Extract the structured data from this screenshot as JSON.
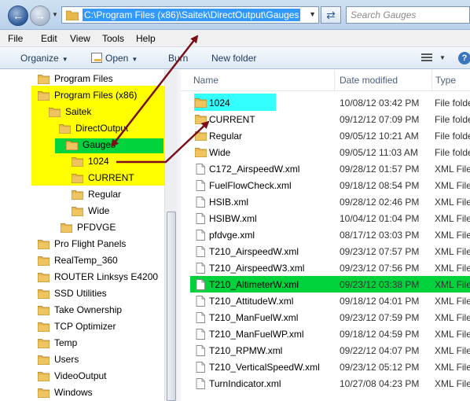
{
  "address": {
    "path": "C:\\Program Files (x86)\\Saitek\\DirectOutput\\Gauges"
  },
  "search": {
    "placeholder": "Search Gauges"
  },
  "menu": [
    "File",
    "Edit",
    "View",
    "Tools",
    "Help"
  ],
  "toolbar": {
    "organize": "Organize",
    "open": "Open",
    "burn": "Burn",
    "new_folder": "New folder"
  },
  "columns": {
    "name": "Name",
    "date": "Date modified",
    "type": "Type"
  },
  "tree": [
    {
      "label": "Program Files"
    },
    {
      "label": "Program Files (x86)"
    },
    {
      "label": "Saitek"
    },
    {
      "label": "DirectOutput"
    },
    {
      "label": "Gauges"
    },
    {
      "label": "1024"
    },
    {
      "label": "CURRENT"
    },
    {
      "label": "Regular"
    },
    {
      "label": "Wide"
    },
    {
      "label": "PFDVGE"
    },
    {
      "label": "Pro Flight Panels"
    },
    {
      "label": "RealTemp_360"
    },
    {
      "label": "ROUTER Linksys E4200"
    },
    {
      "label": "SSD Utilities"
    },
    {
      "label": "Take Ownership"
    },
    {
      "label": "TCP Optimizer"
    },
    {
      "label": "Temp"
    },
    {
      "label": "Users"
    },
    {
      "label": "VideoOutput"
    },
    {
      "label": "Windows"
    }
  ],
  "files": [
    {
      "name": "1024",
      "date": "10/08/12 03:42 PM",
      "type": "File folder",
      "kind": "folder"
    },
    {
      "name": "CURRENT",
      "date": "09/12/12 07:09 PM",
      "type": "File folder",
      "kind": "folder"
    },
    {
      "name": "Regular",
      "date": "09/05/12 10:21 AM",
      "type": "File folder",
      "kind": "folder"
    },
    {
      "name": "Wide",
      "date": "09/05/12 11:03 AM",
      "type": "File folder",
      "kind": "folder"
    },
    {
      "name": "C172_AirspeedW.xml",
      "date": "09/28/12 01:57 PM",
      "type": "XML File",
      "kind": "xml"
    },
    {
      "name": "FuelFlowCheck.xml",
      "date": "09/18/12 08:54 PM",
      "type": "XML File",
      "kind": "xml"
    },
    {
      "name": "HSIB.xml",
      "date": "09/28/12 02:46 PM",
      "type": "XML File",
      "kind": "xml"
    },
    {
      "name": "HSIBW.xml",
      "date": "10/04/12 01:04 PM",
      "type": "XML File",
      "kind": "xml"
    },
    {
      "name": "pfdvge.xml",
      "date": "08/17/12 03:03 PM",
      "type": "XML File",
      "kind": "xml"
    },
    {
      "name": "T210_AirspeedW.xml",
      "date": "09/23/12 07:57 PM",
      "type": "XML File",
      "kind": "xml"
    },
    {
      "name": "T210_AirspeedW3.xml",
      "date": "09/23/12 07:56 PM",
      "type": "XML File",
      "kind": "xml"
    },
    {
      "name": "T210_AltimeterW.xml",
      "date": "09/23/12 03:38 PM",
      "type": "XML File",
      "kind": "xml"
    },
    {
      "name": "T210_AttitudeW.xml",
      "date": "09/18/12 04:01 PM",
      "type": "XML File",
      "kind": "xml"
    },
    {
      "name": "T210_ManFuelW.xml",
      "date": "09/23/12 07:59 PM",
      "type": "XML File",
      "kind": "xml"
    },
    {
      "name": "T210_ManFuelWP.xml",
      "date": "09/18/12 04:59 PM",
      "type": "XML File",
      "kind": "xml"
    },
    {
      "name": "T210_RPMW.xml",
      "date": "09/22/12 04:07 PM",
      "type": "XML File",
      "kind": "xml"
    },
    {
      "name": "T210_VerticalSpeedW.xml",
      "date": "09/23/12 05:12 PM",
      "type": "XML File",
      "kind": "xml"
    },
    {
      "name": "TurnIndicator.xml",
      "date": "10/27/08 04:23 PM",
      "type": "XML File",
      "kind": "xml"
    }
  ],
  "colors": {
    "yellow_highlight": "#ffff00",
    "green_highlight": "#00d23c",
    "cyan_highlight": "#33ffff",
    "arrow": "#7a0f1a",
    "folder": "#e8b64a"
  }
}
